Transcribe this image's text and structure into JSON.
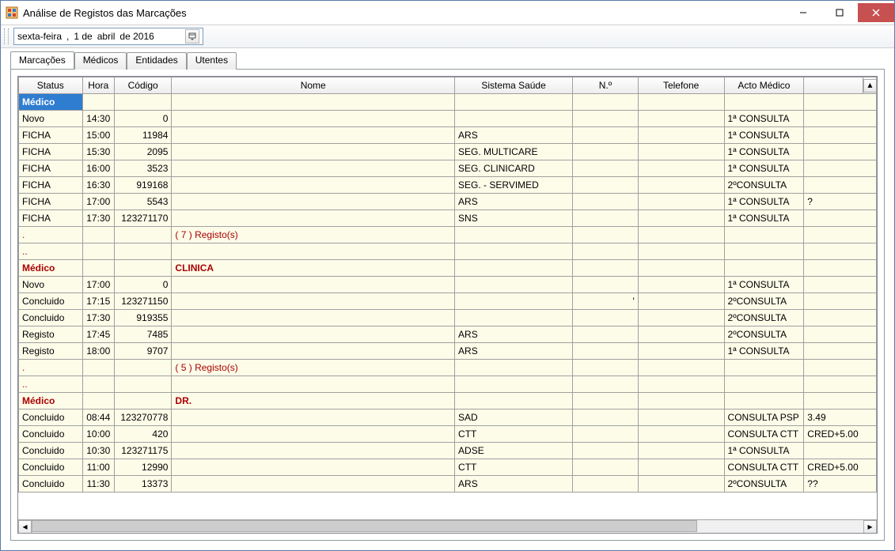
{
  "window": {
    "title": "Análise de Registos das Marcações"
  },
  "datepicker": {
    "weekday": "sexta-feira",
    "comma": ",",
    "day": "1 de",
    "month": "abril",
    "of_year": "de 2016"
  },
  "tabs": [
    {
      "label": "Marcações",
      "active": true
    },
    {
      "label": "Médicos",
      "active": false
    },
    {
      "label": "Entidades",
      "active": false
    },
    {
      "label": "Utentes",
      "active": false
    }
  ],
  "columns": {
    "status": "Status",
    "hora": "Hora",
    "codigo": "Código",
    "nome": "Nome",
    "sistema": "Sistema Saúde",
    "no": "N.º",
    "telefone": "Telefone",
    "acto": "Acto Médico",
    "extra": ""
  },
  "rows": [
    {
      "type": "group",
      "selected": true,
      "status": "Médico",
      "nome": ""
    },
    {
      "type": "data",
      "status": "Novo",
      "hora": "14:30",
      "codigo": "0",
      "nome": "",
      "sistema": "",
      "no": "",
      "telefone": "",
      "acto": "1ª CONSULTA",
      "extra": ""
    },
    {
      "type": "data",
      "status": "FICHA",
      "hora": "15:00",
      "codigo": "11984",
      "nome": "",
      "sistema": "ARS",
      "no": "",
      "telefone": "",
      "acto": "1ª CONSULTA",
      "extra": ""
    },
    {
      "type": "data",
      "status": "FICHA",
      "hora": "15:30",
      "codigo": "2095",
      "nome": "",
      "sistema": "SEG. MULTICARE",
      "no": "",
      "telefone": "",
      "acto": "1ª CONSULTA",
      "extra": ""
    },
    {
      "type": "data",
      "status": "FICHA",
      "hora": "16:00",
      "codigo": "3523",
      "nome": "",
      "sistema": "SEG. CLINICARD",
      "no": "",
      "telefone": "",
      "acto": "1ª CONSULTA",
      "extra": ""
    },
    {
      "type": "data",
      "status": "FICHA",
      "hora": "16:30",
      "codigo": "919168",
      "nome": "",
      "sistema": "SEG. - SERVIMED",
      "no": "",
      "telefone": "",
      "acto": "2ºCONSULTA",
      "extra": ""
    },
    {
      "type": "data",
      "status": "FICHA",
      "hora": "17:00",
      "codigo": "5543",
      "nome": "",
      "sistema": "ARS",
      "no": "",
      "telefone": "",
      "acto": "1ª CONSULTA",
      "extra": "?"
    },
    {
      "type": "data",
      "status": "FICHA",
      "hora": "17:30",
      "codigo": "123271170",
      "nome": "",
      "sistema": "SNS",
      "no": "",
      "telefone": "",
      "acto": "1ª CONSULTA",
      "extra": ""
    },
    {
      "type": "count",
      "status": ".",
      "nome": "( 7 ) Registo(s)"
    },
    {
      "type": "blank",
      "status": ".."
    },
    {
      "type": "group",
      "status": "Médico",
      "nome": "CLINICA"
    },
    {
      "type": "data",
      "status": "Novo",
      "hora": "17:00",
      "codigo": "0",
      "nome": "",
      "sistema": "",
      "no": "",
      "telefone": "",
      "acto": "1ª CONSULTA",
      "extra": ""
    },
    {
      "type": "data",
      "status": "Concluido",
      "hora": "17:15",
      "codigo": "123271150",
      "nome": "",
      "sistema": "",
      "no": "'",
      "telefone": "",
      "acto": "2ºCONSULTA",
      "extra": ""
    },
    {
      "type": "data",
      "status": "Concluido",
      "hora": "17:30",
      "codigo": "919355",
      "nome": "",
      "sistema": "",
      "no": "",
      "telefone": "",
      "acto": "2ºCONSULTA",
      "extra": ""
    },
    {
      "type": "data",
      "status": "Registo",
      "hora": "17:45",
      "codigo": "7485",
      "nome": "",
      "sistema": "ARS",
      "no": "",
      "telefone": "",
      "acto": "2ºCONSULTA",
      "extra": ""
    },
    {
      "type": "data",
      "status": "Registo",
      "hora": "18:00",
      "codigo": "9707",
      "nome": "",
      "sistema": "ARS",
      "no": "",
      "telefone": "",
      "acto": "1ª CONSULTA",
      "extra": ""
    },
    {
      "type": "count",
      "status": ".",
      "nome": "( 5 ) Registo(s)"
    },
    {
      "type": "blank",
      "status": ".."
    },
    {
      "type": "group",
      "status": "Médico",
      "nome": "DR."
    },
    {
      "type": "data",
      "status": "Concluido",
      "hora": "08:44",
      "codigo": "123270778",
      "nome": "",
      "sistema": "SAD",
      "no": "",
      "telefone": "",
      "acto": "CONSULTA PSP",
      "extra": "3.49"
    },
    {
      "type": "data",
      "status": "Concluido",
      "hora": "10:00",
      "codigo": "420",
      "nome": "",
      "sistema": "CTT",
      "no": "",
      "telefone": "",
      "acto": "CONSULTA CTT",
      "extra": "CRED+5.00"
    },
    {
      "type": "data",
      "status": "Concluido",
      "hora": "10:30",
      "codigo": "123271175",
      "nome": "",
      "sistema": "ADSE",
      "no": "",
      "telefone": "",
      "acto": "1ª CONSULTA",
      "extra": ""
    },
    {
      "type": "data",
      "status": "Concluido",
      "hora": "11:00",
      "codigo": "12990",
      "nome": "",
      "sistema": "CTT",
      "no": "",
      "telefone": "",
      "acto": "CONSULTA CTT",
      "extra": "CRED+5.00"
    },
    {
      "type": "data",
      "status": "Concluido",
      "hora": "11:30",
      "codigo": "13373",
      "nome": "",
      "sistema": "ARS",
      "no": "",
      "telefone": "",
      "acto": "2ºCONSULTA",
      "extra": "??"
    }
  ]
}
